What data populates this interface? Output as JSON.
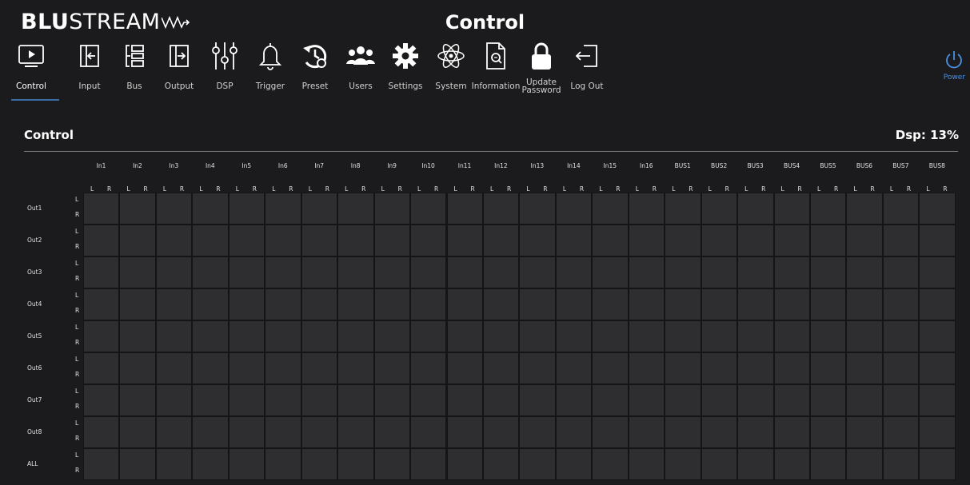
{
  "header": {
    "logo_bold": "BLU",
    "logo_thin": "STREAM",
    "title": "Control"
  },
  "nav": [
    {
      "label": "Control",
      "icon": "play-icon",
      "active": true
    },
    {
      "label": "Input",
      "icon": "input-icon"
    },
    {
      "label": "Bus",
      "icon": "bus-icon"
    },
    {
      "label": "Output",
      "icon": "output-icon"
    },
    {
      "label": "DSP",
      "icon": "dsp-sliders-icon"
    },
    {
      "label": "Trigger",
      "icon": "bell-icon"
    },
    {
      "label": "Preset",
      "icon": "preset-icon"
    },
    {
      "label": "Users",
      "icon": "users-icon"
    },
    {
      "label": "Settings",
      "icon": "gear-icon"
    },
    {
      "label": "System",
      "icon": "atom-icon"
    },
    {
      "label": "Information",
      "icon": "document-search-icon"
    },
    {
      "label": "Update Password",
      "icon": "lock-icon"
    },
    {
      "label": "Log Out",
      "icon": "logout-icon"
    }
  ],
  "power": {
    "label": "Power",
    "color": "#4a90e2"
  },
  "section": {
    "title": "Control",
    "dsp": "Dsp: 13%"
  },
  "matrix": {
    "columns": [
      "In1",
      "In2",
      "In3",
      "In4",
      "In5",
      "In6",
      "In7",
      "In8",
      "In9",
      "In10",
      "In11",
      "In12",
      "In13",
      "In14",
      "In15",
      "In16",
      "BUS1",
      "BUS2",
      "BUS3",
      "BUS4",
      "BUS5",
      "BUS6",
      "BUS7",
      "BUS8"
    ],
    "rows": [
      "Out1",
      "Out2",
      "Out3",
      "Out4",
      "Out5",
      "Out6",
      "Out7",
      "Out8",
      "ALL"
    ],
    "channel_left": "L",
    "channel_right": "R"
  }
}
